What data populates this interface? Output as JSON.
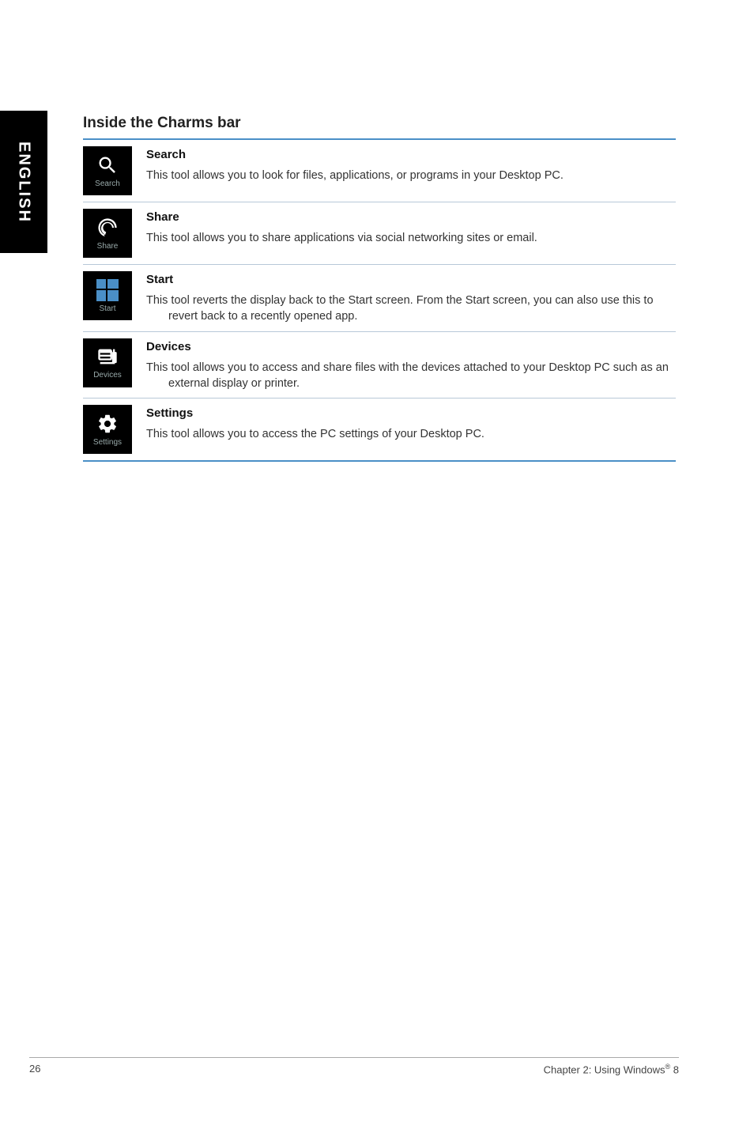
{
  "sidebar": {
    "language": "ENGLISH"
  },
  "heading": "Inside the Charms bar",
  "charms": [
    {
      "iconName": "search-icon",
      "iconLabel": "Search",
      "title": "Search",
      "desc": "This tool allows you to look for files, applications, or programs in your Desktop PC."
    },
    {
      "iconName": "share-icon",
      "iconLabel": "Share",
      "title": "Share",
      "desc": "This tool allows you to share applications via social networking sites or email."
    },
    {
      "iconName": "start-icon",
      "iconLabel": "Start",
      "title": "Start",
      "desc": "This tool reverts the display back to the Start screen. From the Start screen, you can also use this to revert back to a recently opened app."
    },
    {
      "iconName": "devices-icon",
      "iconLabel": "Devices",
      "title": "Devices",
      "desc": "This tool allows you to access and share files with the devices attached to your Desktop PC such as an external display or printer."
    },
    {
      "iconName": "settings-icon",
      "iconLabel": "Settings",
      "title": "Settings",
      "desc": "This tool allows you to access the PC settings of your Desktop PC."
    }
  ],
  "footer": {
    "pageNumber": "26",
    "chapter": "Chapter 2: Using Windows",
    "chapterSuffix": " 8",
    "reg": "®"
  }
}
